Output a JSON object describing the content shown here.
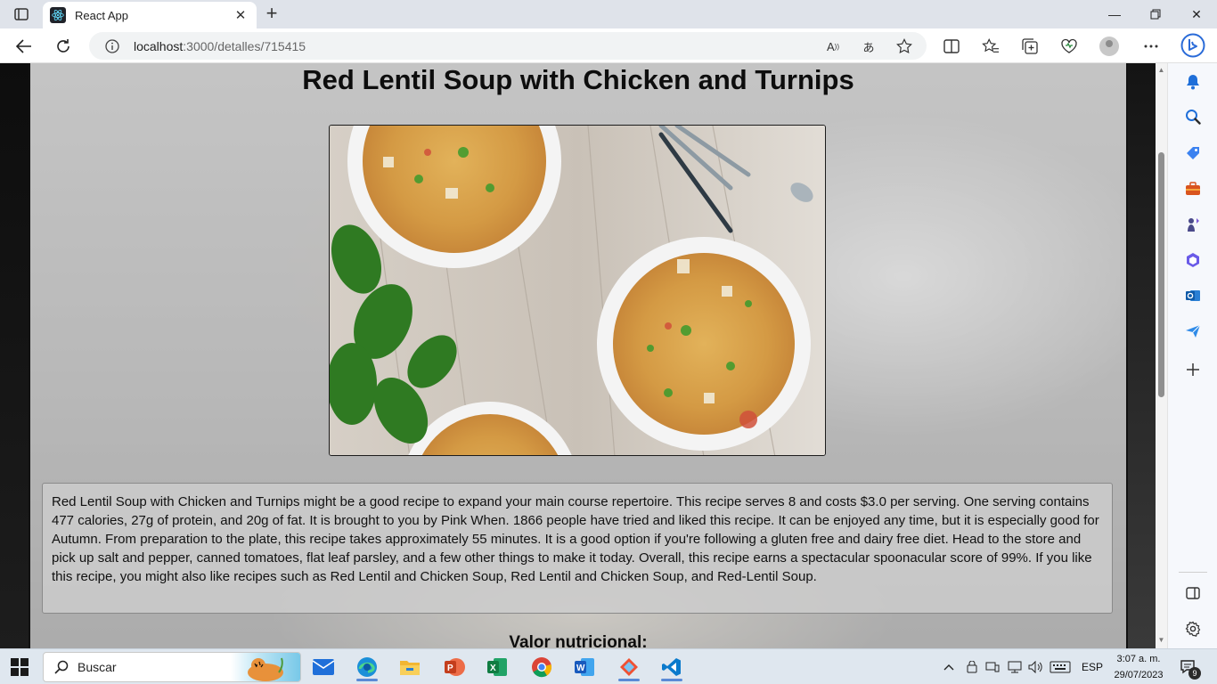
{
  "browser": {
    "tab_title": "React App",
    "url_host": "localhost",
    "url_rest": ":3000/detalles/715415"
  },
  "recipe": {
    "title": "Red Lentil Soup with Chicken and Turnips",
    "image_alt": "Red Lentil Soup with Chicken and Turnips",
    "summary": "Red Lentil Soup with Chicken and Turnips might be a good recipe to expand your main course repertoire. This recipe serves 8 and costs $3.0 per serving. One serving contains 477 calories, 27g of protein, and 20g of fat. It is brought to you by Pink When. 1866 people have tried and liked this recipe. It can be enjoyed any time, but it is especially good for Autumn. From preparation to the plate, this recipe takes approximately 55 minutes. It is a good option if you're following a gluten free and dairy free diet. Head to the store and pick up salt and pepper, canned tomatoes, flat leaf parsley, and a few other things to make it today. Overall, this recipe earns a spectacular spoonacular score of 99%. If you like this recipe, you might also like recipes such as Red Lentil and Chicken Soup, Red Lentil and Chicken Soup, and Red-Lentil Soup.",
    "nutrition_heading": "Valor nutricional:"
  },
  "taskbar": {
    "search_label": "Buscar",
    "language": "ESP",
    "time": "3:07 a. m.",
    "date": "29/07/2023",
    "notification_count": "9"
  },
  "icons": {
    "sidebar": [
      "bell-icon",
      "search-icon",
      "tag-icon",
      "briefcase-icon",
      "chess-icon",
      "office-icon",
      "outlook-icon",
      "send-icon",
      "add-icon",
      "split-screen-icon",
      "settings-icon"
    ],
    "taskbar_apps": [
      "mail-icon",
      "edge-icon",
      "file-explorer-icon",
      "powerpoint-icon",
      "excel-icon",
      "chrome-icon",
      "word-icon",
      "app-icon",
      "vscode-icon"
    ]
  },
  "colors": {
    "edge_blue": "#0c59a4",
    "taskbar_bg": "#dfe7ef"
  }
}
